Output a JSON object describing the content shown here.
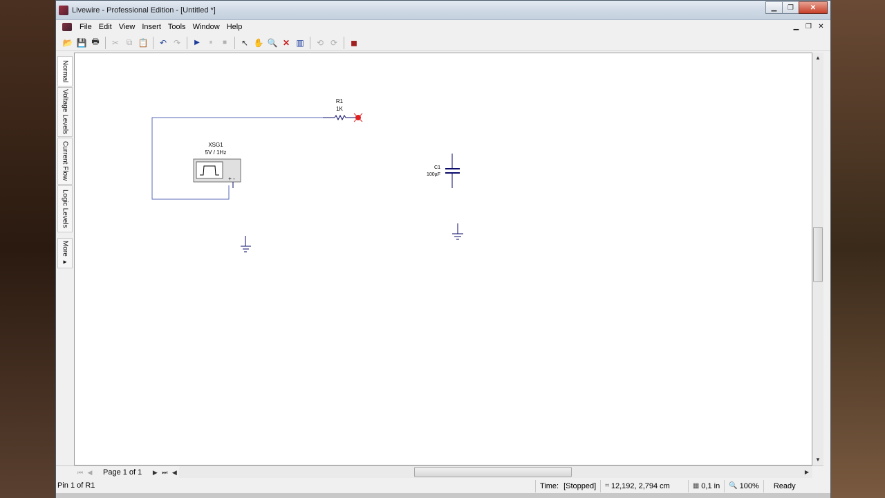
{
  "window": {
    "title": "Livewire - Professional Edition - [Untitled *]",
    "minimize": "▁",
    "restore": "❐",
    "close": "✕"
  },
  "menubar": {
    "items": [
      "File",
      "Edit",
      "View",
      "Insert",
      "Tools",
      "Window",
      "Help"
    ],
    "mdi_minimize": "▁",
    "mdi_restore": "❐",
    "mdi_close": "✕"
  },
  "toolbar": {
    "open": "📂",
    "save": "💾",
    "print": "🖶",
    "cut": "✂",
    "copy": "⧉",
    "paste": "📋",
    "undo": "↶",
    "redo": "↷",
    "run": "▶",
    "pause": "⏸",
    "stop": "■",
    "select": "↖",
    "pan": "✋",
    "zoom": "🔍",
    "delete": "✕",
    "chart": "▥",
    "rotate_left": "⟲",
    "rotate_right": "⟳",
    "component": "◼"
  },
  "left_tabs": {
    "normal": "Normal",
    "voltage": "Voltage Levels",
    "current": "Current Flow",
    "logic": "Logic Levels",
    "more": "More ▸"
  },
  "circuit": {
    "r1_name": "R1",
    "r1_value": "1K",
    "xsg1_name": "XSG1",
    "xsg1_value": "5V / 1Hz",
    "xsg1_terminals": "+ -",
    "c1_name": "C1",
    "c1_value": "100µF"
  },
  "bottom": {
    "first": "⏮",
    "prev": "◀",
    "page_label": "Page 1 of 1",
    "next": "▶",
    "last": "⏭",
    "scroll_left": "◀",
    "scroll_right": "▶",
    "scroll_up": "▲",
    "scroll_down": "▼"
  },
  "status": {
    "left": "Pin 1 of R1",
    "time_label": "Time:",
    "time_value": "[Stopped]",
    "coords": "12,192, 2,794 cm",
    "grid": "0,1 in",
    "zoom": "100%",
    "state": "Ready"
  },
  "colors": {
    "wire": "#5a6ab8",
    "component": "#0a0a6a",
    "pin_highlight": "#e02020"
  }
}
